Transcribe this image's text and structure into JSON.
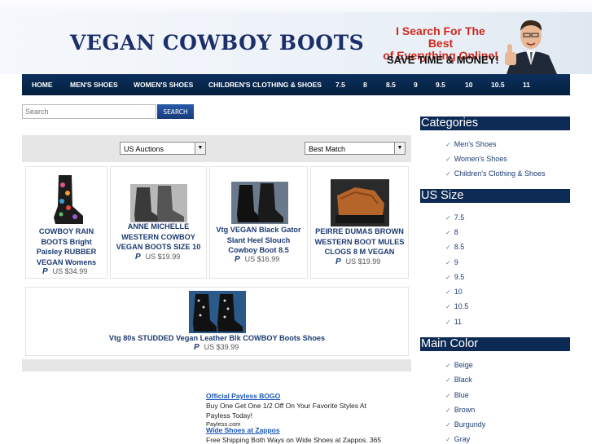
{
  "header": {
    "title": "VEGAN COWBOY BOOTS",
    "promo_line1": "I Search For The Best",
    "promo_line2": "of Everything Online!",
    "promo_line3": "SAVE TIME & MONEY!"
  },
  "nav": [
    "HOME",
    "MEN'S SHOES",
    "WOMEN'S SHOES",
    "CHILDREN'S CLOTHING & SHOES",
    "7.5",
    "8",
    "8.5",
    "9",
    "9.5",
    "10",
    "10.5",
    "11"
  ],
  "search": {
    "placeholder": "Search",
    "button": "SEARCH"
  },
  "filters": {
    "auction_type": "US Auctions",
    "sort": "Best Match"
  },
  "listings": [
    {
      "title": "COWBOY RAIN BOOTS Bright Paisley RUBBER VEGAN Womens",
      "price": "US $34.99"
    },
    {
      "title": "ANNE MICHELLE WESTERN COWBOY VEGAN BOOTS SIZE 10",
      "price": "US $19.99"
    },
    {
      "title": "Vtg VEGAN Black Gator Slant Heel Slouch Cowboy Boot 8.5",
      "price": "US $16.99"
    },
    {
      "title": "PEIRRE DUMAS BROWN WESTERN BOOT MULES CLOGS 8 M VEGAN",
      "price": "US $19.99"
    },
    {
      "title": "Vtg 80s STUDDED Vegan Leather Blk COWBOY Boots Shoes",
      "price": "US $39.99"
    }
  ],
  "ads": [
    {
      "link": "Official Payless BOGO",
      "text1": "Buy One Get One 1/2 Off On Your Favorite Styles At",
      "text2": "Payless Today!",
      "url": "Payless.com"
    },
    {
      "link": "Wide Shoes at Zappos",
      "text1": "Free Shipping Both Ways on Wide Shoes at Zappos. 365"
    }
  ],
  "sidebar": {
    "categories": {
      "title": "Categories",
      "items": [
        "Men's Shoes",
        "Women's Shoes",
        "Children's Clothing & Shoes"
      ]
    },
    "us_size": {
      "title": "US Size",
      "items": [
        "7.5",
        "8",
        "8.5",
        "9",
        "9.5",
        "10",
        "10.5",
        "11"
      ]
    },
    "main_color": {
      "title": "Main Color",
      "items": [
        "Beige",
        "Black",
        "Blue",
        "Brown",
        "Burgundy",
        "Gray"
      ]
    }
  },
  "icons": {
    "paypal": "paypal-icon",
    "check": "check-icon",
    "dropdown": "chevron-down-icon"
  },
  "colors": {
    "nav_bg": "#0c2f5c",
    "title": "#1c2f6b",
    "promo_red": "#d0281c",
    "link": "#1a55b8"
  }
}
